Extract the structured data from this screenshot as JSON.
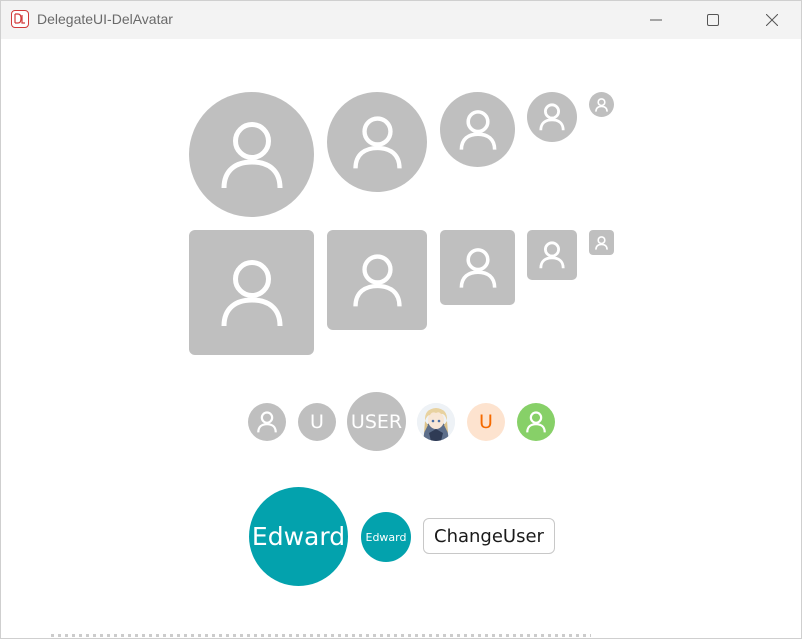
{
  "window": {
    "title": "DelegateUI-DelAvatar",
    "controls": [
      "minimize-icon",
      "maximize-icon",
      "close-icon"
    ]
  },
  "icon_avatars": {
    "circle_row": [
      "user-icon",
      "user-icon",
      "user-icon",
      "user-icon",
      "user-icon"
    ],
    "square_row": [
      "user-icon",
      "user-icon",
      "user-icon",
      "user-icon",
      "user-icon"
    ]
  },
  "mixed_row": {
    "icon_avatar": "user-icon",
    "letter_avatar": "U",
    "text_avatar": "USER",
    "image_avatar": "anime-girl-image",
    "colored_letter_avatar": "U",
    "colored_icon_avatar": "user-icon"
  },
  "user_row": {
    "large_name": "Edward",
    "small_name": "Edward",
    "change_button": "ChangeUser"
  },
  "colors": {
    "avatar_gray": "#bfbfbf",
    "teal": "#03a2ad",
    "peach_bg": "#fde3cf",
    "orange_text": "#f56a00",
    "green_bg": "#87d068"
  }
}
